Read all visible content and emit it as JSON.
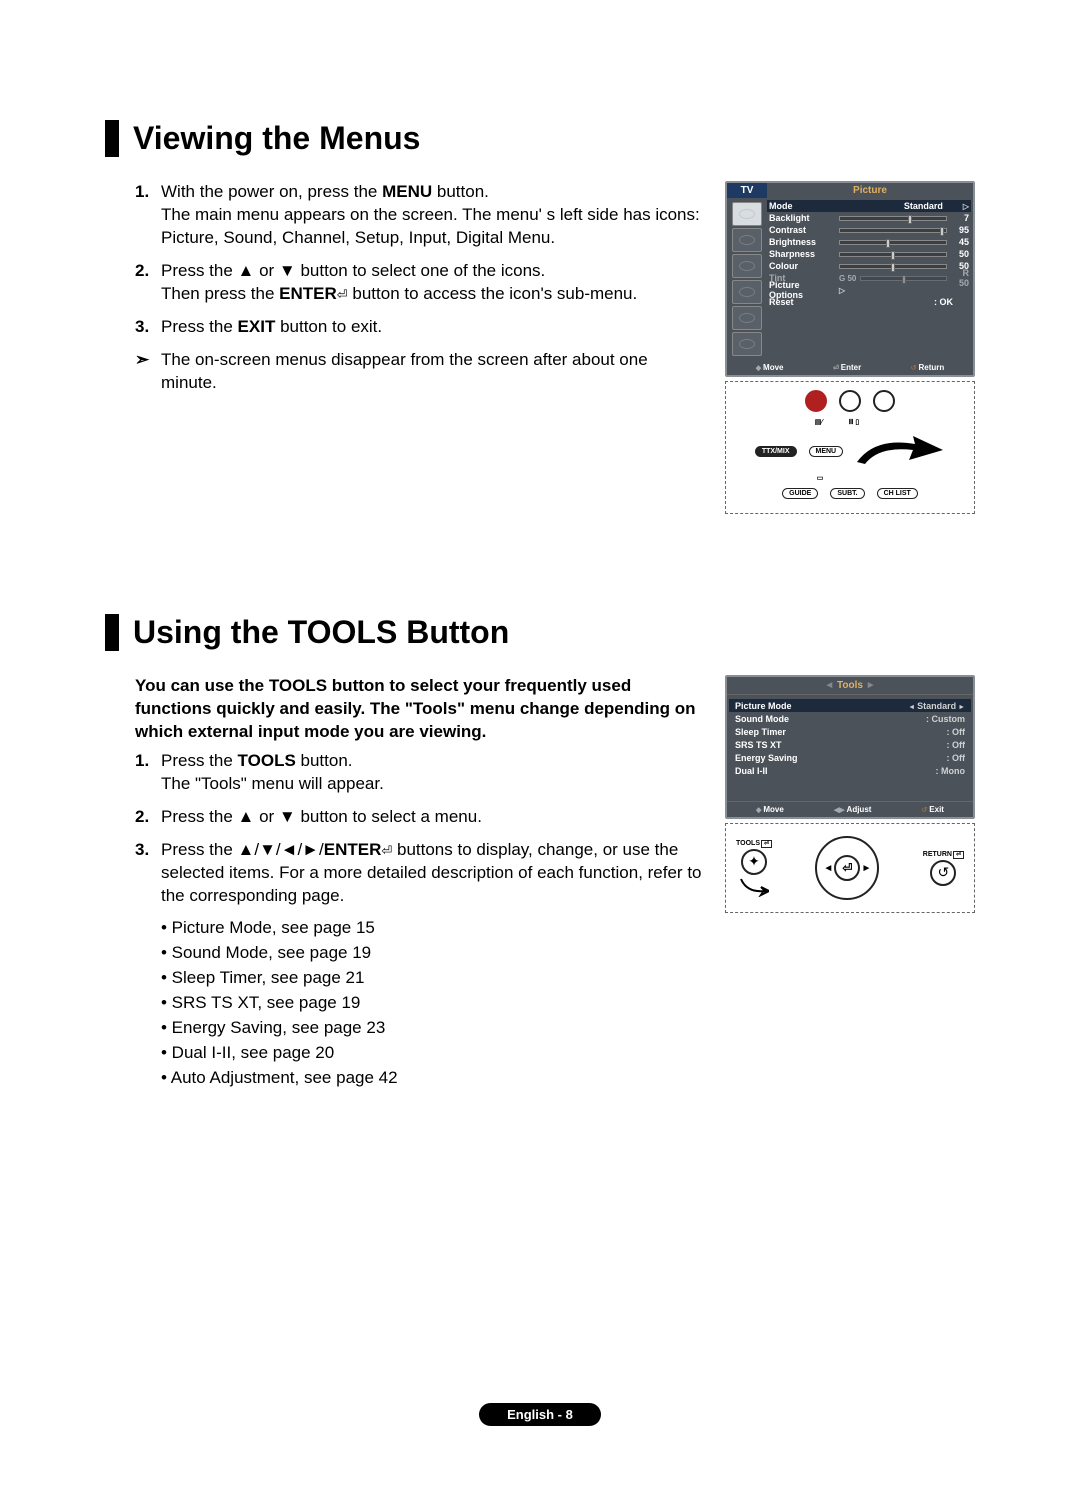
{
  "section1": {
    "title": "Viewing the Menus",
    "step1_a": "With the power on, press the ",
    "step1_bold": "MENU",
    "step1_b": " button.",
    "step1_c": "The main menu appears on the screen. The menu' s left side has icons: Picture, Sound, Channel, Setup, Input, Digital Menu.",
    "step2_a": "Press the ▲ or ▼ button to select one of the icons.",
    "step2_b": "Then press the ",
    "step2_bold": "ENTER",
    "step2_c": " button to access the icon's sub-menu.",
    "step3_a": "Press the ",
    "step3_bold": "EXIT",
    "step3_b": " button to exit.",
    "note": "The on-screen menus disappear from the screen after about one minute."
  },
  "osd1": {
    "tv": "TV",
    "title": "Picture",
    "rows": [
      {
        "label": "Mode",
        "right": "Standard",
        "tri": true,
        "hl": true
      },
      {
        "label": "Backlight",
        "val": "7",
        "knob": 66
      },
      {
        "label": "Contrast",
        "val": "95",
        "knob": 96
      },
      {
        "label": "Brightness",
        "val": "45",
        "knob": 45
      },
      {
        "label": "Sharpness",
        "val": "50",
        "knob": 50
      },
      {
        "label": "Colour",
        "val": "50",
        "knob": 50
      },
      {
        "label": "Tint",
        "val": "R 50",
        "left": "G 50",
        "knob": 50,
        "dim": true
      },
      {
        "label": "Picture Options",
        "tri": true
      },
      {
        "label": "Reset",
        "right": ": OK"
      }
    ],
    "nav": {
      "move": "Move",
      "enter": "Enter",
      "return": "Return"
    }
  },
  "remote1": {
    "ttx": "TTX/MIX",
    "menu": "MENU",
    "guide": "GUIDE",
    "subt": "SUBT.",
    "chlist": "CH LIST"
  },
  "section2": {
    "title": "Using the TOOLS Button",
    "intro": "You can use the TOOLS button to select your frequently used functions quickly and easily. The \"Tools\" menu change depending on which external input mode you are viewing.",
    "step1_a": "Press the ",
    "step1_bold": "TOOLS",
    "step1_b": " button.",
    "step1_c": "The \"Tools\" menu will appear.",
    "step2": "Press the ▲ or ▼ button to select a menu.",
    "step3_a": "Press the ▲/▼/◄/►/",
    "step3_bold": "ENTER",
    "step3_b": " buttons to display, change, or use the selected items. For a more detailed description of each function, refer to the corresponding page.",
    "refs": [
      "• Picture Mode, see page 15",
      "• Sound Mode, see page 19",
      "• Sleep Timer, see page 21",
      "• SRS TS XT, see page 19",
      "• Energy Saving, see page 23",
      "• Dual I-II, see page 20",
      "• Auto Adjustment, see page 42"
    ]
  },
  "osd2": {
    "title": "Tools",
    "rows": [
      {
        "label": "Picture Mode",
        "val": "Standard",
        "hl": true,
        "arr": true
      },
      {
        "label": "Sound Mode",
        "val": ":  Custom"
      },
      {
        "label": "Sleep Timer",
        "val": ":  Off"
      },
      {
        "label": "SRS TS XT",
        "val": ":  Off"
      },
      {
        "label": "Energy Saving",
        "val": ":  Off"
      },
      {
        "label": "Dual I-II",
        "val": ":  Mono"
      }
    ],
    "nav": {
      "move": "Move",
      "adjust": "Adjust",
      "exit": "Exit"
    }
  },
  "remote2": {
    "tools": "TOOLS",
    "ret": "RETURN",
    "enter": "⏎"
  },
  "footer": "English - 8"
}
